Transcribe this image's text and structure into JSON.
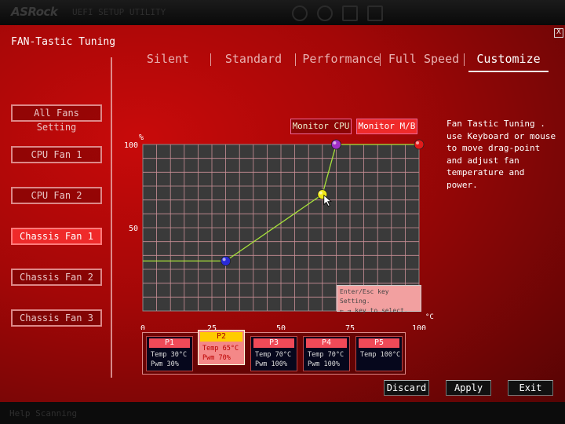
{
  "top_bar": {
    "brand": "ASRock",
    "ghost_text": "UEFI SETUP UTILITY"
  },
  "window": {
    "title": "FAN-Tastic Tuning",
    "close_label": "X"
  },
  "sidebar": {
    "items": [
      {
        "label": "All Fans Setting",
        "active": false
      },
      {
        "label": "CPU Fan 1",
        "active": false
      },
      {
        "label": "CPU Fan 2",
        "active": false
      },
      {
        "label": "Chassis Fan 1",
        "active": true
      },
      {
        "label": "Chassis Fan 2",
        "active": false
      },
      {
        "label": "Chassis Fan 3",
        "active": false
      }
    ]
  },
  "tabs": [
    {
      "label": "Silent",
      "selected": false
    },
    {
      "label": "Standard",
      "selected": false
    },
    {
      "label": "Performance",
      "selected": false
    },
    {
      "label": "Full Speed",
      "selected": false
    },
    {
      "label": "Customize",
      "selected": true
    }
  ],
  "monitor": {
    "cpu_label": "Monitor CPU",
    "mb_label": "Monitor M/B",
    "active": "mb"
  },
  "help_text": "Fan Tastic Tuning . use Keyboard or mouse to move drag-point and adjust fan temperature and power.",
  "hint": {
    "line1": "Enter/Esc key Setting.",
    "line2": "← → key to select."
  },
  "chart_data": {
    "type": "line",
    "y_unit_label": "%",
    "x_unit_label": "°C",
    "x_ticks": [
      "0",
      "25",
      "50",
      "75",
      "100"
    ],
    "y_ticks": [
      "50",
      "100"
    ],
    "xlim": [
      0,
      100
    ],
    "ylim": [
      0,
      100
    ],
    "grid": true,
    "points": [
      {
        "name": "P1",
        "temp": 30,
        "pwm": 30,
        "color": "#2a2ad6"
      },
      {
        "name": "P2",
        "temp": 65,
        "pwm": 70,
        "color": "#f0e81a"
      },
      {
        "name": "P3",
        "temp": 70,
        "pwm": 100,
        "color": "#a030c8"
      },
      {
        "name": "P4",
        "temp": 70,
        "pwm": 100,
        "color": "#a030c8"
      },
      {
        "name": "P5",
        "temp": 100,
        "pwm": 100,
        "color": "#e21a1a"
      }
    ],
    "line_color": "#a8e23a"
  },
  "points_table": [
    {
      "name": "P1",
      "temp": "Temp 30°C",
      "pwm": "Pwm  30%",
      "selected": false
    },
    {
      "name": "P2",
      "temp": "Temp 65°C",
      "pwm": "Pwm  70%",
      "selected": true
    },
    {
      "name": "P3",
      "temp": "Temp 70°C",
      "pwm": "Pwm  100%",
      "selected": false
    },
    {
      "name": "P4",
      "temp": "Temp 70°C",
      "pwm": "Pwm  100%",
      "selected": false
    },
    {
      "name": "P5",
      "temp": "Temp 100°C",
      "pwm": "",
      "selected": false
    }
  ],
  "actions": {
    "discard": "Discard",
    "apply": "Apply",
    "exit": "Exit"
  },
  "bottom_bar": {
    "ghost_text": "Help Scanning"
  },
  "colors": {
    "accent_red": "#ef2a2a",
    "panel_red": "#a30707",
    "selected_point": "#ffcc00"
  }
}
